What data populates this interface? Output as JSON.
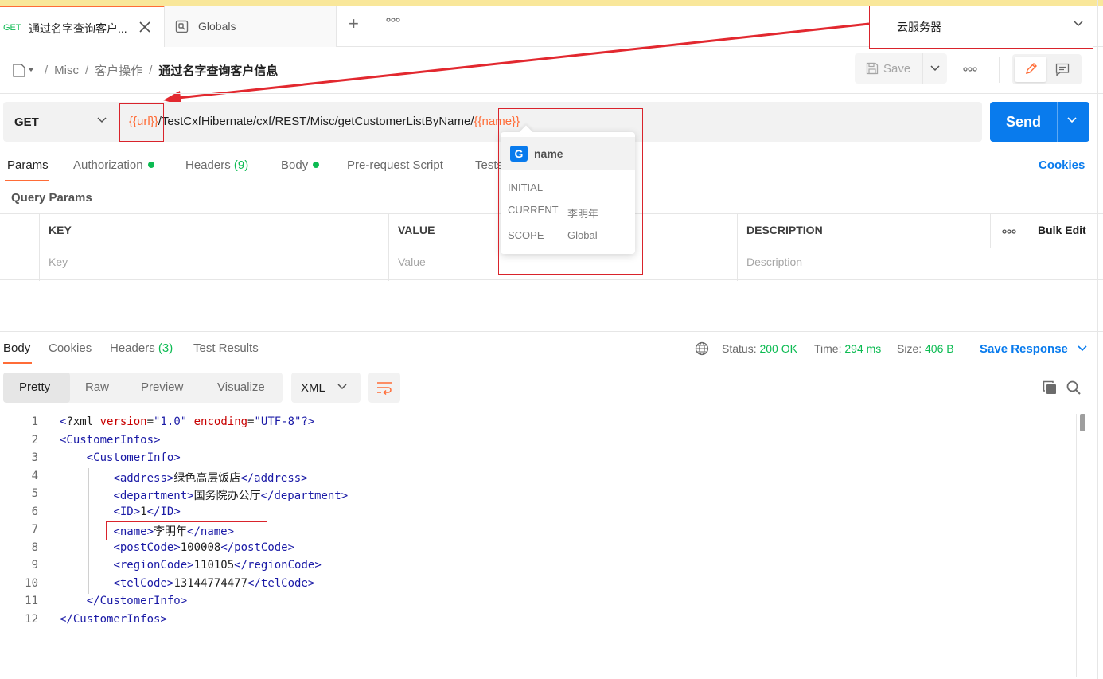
{
  "tabs": [
    {
      "method": "GET",
      "title": "通过名字查询客户...",
      "active": true
    },
    {
      "title": "Globals",
      "active": false
    }
  ],
  "environment": {
    "selected": "云服务器"
  },
  "breadcrumb": {
    "items": [
      "Misc",
      "客户操作"
    ],
    "current": "通过名字查询客户信息"
  },
  "toolbar": {
    "save_label": "Save"
  },
  "request": {
    "method": "GET",
    "url_var": "{{url}}",
    "url_path": "/TestCxfHibernate/cxf/REST/Misc/getCustomerListByName/",
    "url_var2": "{{name}}",
    "send_label": "Send"
  },
  "request_tabs": {
    "params": "Params",
    "authorization": "Authorization",
    "headers": "Headers",
    "headers_count": "(9)",
    "body": "Body",
    "prerequest": "Pre-request Script",
    "tests": "Tests",
    "cookies": "Cookies"
  },
  "query_params": {
    "title": "Query Params",
    "columns": {
      "key": "KEY",
      "value": "VALUE",
      "description": "DESCRIPTION"
    },
    "bulk_edit": "Bulk Edit",
    "placeholders": {
      "key": "Key",
      "value": "Value",
      "description": "Description"
    }
  },
  "var_popup": {
    "badge": "G",
    "name": "name",
    "initial_label": "INITIAL",
    "initial_value": "",
    "current_label": "CURRENT",
    "current_value": "李明年",
    "scope_label": "SCOPE",
    "scope_value": "Global"
  },
  "response": {
    "tabs": {
      "body": "Body",
      "cookies": "Cookies",
      "headers": "Headers",
      "headers_count": "(3)",
      "tests": "Test Results"
    },
    "status_label": "Status:",
    "status_value": "200 OK",
    "time_label": "Time:",
    "time_value": "294 ms",
    "size_label": "Size:",
    "size_value": "406 B",
    "save_response": "Save Response",
    "views": [
      "Pretty",
      "Raw",
      "Preview",
      "Visualize"
    ],
    "format": "XML"
  },
  "code_lines": [
    {
      "n": "1",
      "text": "<?xml version=\"1.0\" encoding=\"UTF-8\"?>"
    },
    {
      "n": "2",
      "text": "<CustomerInfos>"
    },
    {
      "n": "3",
      "text": "    <CustomerInfo>"
    },
    {
      "n": "4",
      "text": "        <address>绿色高层饭店</address>"
    },
    {
      "n": "5",
      "text": "        <department>国务院办公厅</department>"
    },
    {
      "n": "6",
      "text": "        <ID>1</ID>"
    },
    {
      "n": "7",
      "text": "        <name>李明年</name>"
    },
    {
      "n": "8",
      "text": "        <postCode>100008</postCode>"
    },
    {
      "n": "9",
      "text": "        <regionCode>110105</regionCode>"
    },
    {
      "n": "10",
      "text": "        <telCode>13144774477</telCode>"
    },
    {
      "n": "11",
      "text": "    </CustomerInfo>"
    },
    {
      "n": "12",
      "text": "</CustomerInfos>"
    }
  ],
  "colors": {
    "accent": "#ff6c37",
    "primary": "#097bed",
    "success": "#0cbb52",
    "annotation": "#d9232b"
  }
}
